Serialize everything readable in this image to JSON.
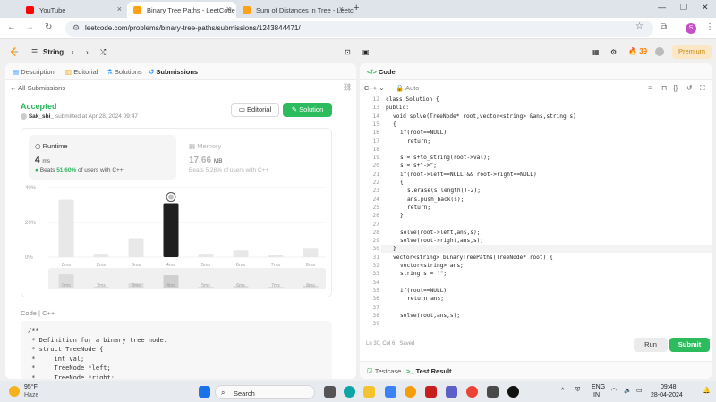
{
  "browser": {
    "tabs": [
      {
        "title": "YouTube",
        "active": false,
        "color": "#ff0000"
      },
      {
        "title": "Binary Tree Paths - LeetCode",
        "active": true,
        "color": "#ffa116"
      },
      {
        "title": "Sum of Distances in Tree - Leetc",
        "active": false,
        "color": "#ffa116"
      }
    ],
    "url": "leetcode.com/problems/binary-tree-paths/submissions/1243844471/",
    "profile_initial": "S"
  },
  "lc_nav": {
    "problem_list": "String",
    "streak_count": "39",
    "premium_label": "Premium"
  },
  "left_tabs": [
    "Description",
    "Editorial",
    "Solutions",
    "Submissions"
  ],
  "submission": {
    "back_label": "All Submissions",
    "status": "Accepted",
    "author": "Sak_shi_",
    "submitted_at": "submitted at Apr 28, 2024 09:47",
    "editorial_btn": "Editorial",
    "solution_btn": "Solution"
  },
  "runtime": {
    "label": "Runtime",
    "value": "4",
    "unit": "ms",
    "beats_prefix": "Beats",
    "beats_pct": "51.60%",
    "beats_suffix": "of users with C++"
  },
  "memory": {
    "label": "Memory",
    "value": "17.66",
    "unit": "MB",
    "beats_prefix": "Beats",
    "beats_pct": "5.28%",
    "beats_suffix": "of users with C++"
  },
  "chart_data": {
    "type": "bar",
    "categories": [
      "0ms",
      "2ms",
      "3ms",
      "4ms",
      "5ms",
      "6ms",
      "7ms",
      "8ms"
    ],
    "values": [
      33,
      2,
      11,
      31,
      2,
      4,
      1,
      5
    ],
    "highlight_category": "4ms",
    "y_ticks": [
      "40%",
      "20%",
      "0%"
    ],
    "ylim": [
      0,
      40
    ],
    "colors": {
      "bar": "#e8e8e8",
      "highlight": "#1f1f1f"
    }
  },
  "code_section": {
    "label": "Code",
    "lang": "C++",
    "snippet": [
      "/**",
      " * Definition for a binary tree node.",
      " * struct TreeNode {",
      " *     int val;",
      " *     TreeNode *left;",
      " *     TreeNode *right;"
    ]
  },
  "editor": {
    "title": "Code",
    "language": "C++",
    "mode": "Auto",
    "status": "Ln 30, Col 6",
    "saved": "Saved",
    "run_label": "Run",
    "submit_label": "Submit",
    "bottom_tabs": [
      "Testcase",
      "Test Result"
    ],
    "current_line": 30,
    "lines": [
      {
        "n": 12,
        "indent": 0,
        "text": "class Solution {"
      },
      {
        "n": 13,
        "indent": 0,
        "text": "public:"
      },
      {
        "n": 14,
        "indent": 2,
        "text": "void solve(TreeNode* root,vector<string> &ans,string s)"
      },
      {
        "n": 15,
        "indent": 2,
        "text": "{"
      },
      {
        "n": 16,
        "indent": 4,
        "text": "if(root==NULL)"
      },
      {
        "n": 17,
        "indent": 6,
        "text": "return;"
      },
      {
        "n": 18,
        "indent": 0,
        "text": ""
      },
      {
        "n": 19,
        "indent": 4,
        "text": "s = s+to_string(root->val);"
      },
      {
        "n": 20,
        "indent": 4,
        "text": "s = s+\"->\";"
      },
      {
        "n": 21,
        "indent": 4,
        "text": "if(root->left==NULL && root->right==NULL)"
      },
      {
        "n": 22,
        "indent": 4,
        "text": "{"
      },
      {
        "n": 23,
        "indent": 6,
        "text": "s.erase(s.length()-2);"
      },
      {
        "n": 24,
        "indent": 6,
        "text": "ans.push_back(s);"
      },
      {
        "n": 25,
        "indent": 6,
        "text": "return;"
      },
      {
        "n": 26,
        "indent": 4,
        "text": "}"
      },
      {
        "n": 27,
        "indent": 0,
        "text": ""
      },
      {
        "n": 28,
        "indent": 4,
        "text": "solve(root->left,ans,s);"
      },
      {
        "n": 29,
        "indent": 4,
        "text": "solve(root->right,ans,s);"
      },
      {
        "n": 30,
        "indent": 2,
        "text": "}"
      },
      {
        "n": 31,
        "indent": 2,
        "text": "vector<string> binaryTreePaths(TreeNode* root) {"
      },
      {
        "n": 32,
        "indent": 4,
        "text": "vector<string> ans;"
      },
      {
        "n": 33,
        "indent": 4,
        "text": "string s = \"\";"
      },
      {
        "n": 34,
        "indent": 0,
        "text": ""
      },
      {
        "n": 35,
        "indent": 4,
        "text": "if(root==NULL)"
      },
      {
        "n": 36,
        "indent": 6,
        "text": "return ans;"
      },
      {
        "n": 37,
        "indent": 0,
        "text": ""
      },
      {
        "n": 38,
        "indent": 4,
        "text": "solve(root,ans,s);"
      },
      {
        "n": 39,
        "indent": 0,
        "text": ""
      }
    ]
  },
  "taskbar": {
    "temp": "95°F",
    "weather": "Haze",
    "search_placeholder": "Search",
    "lang_top": "ENG",
    "lang_bottom": "IN",
    "time": "09:48",
    "date": "28-04-2024"
  }
}
